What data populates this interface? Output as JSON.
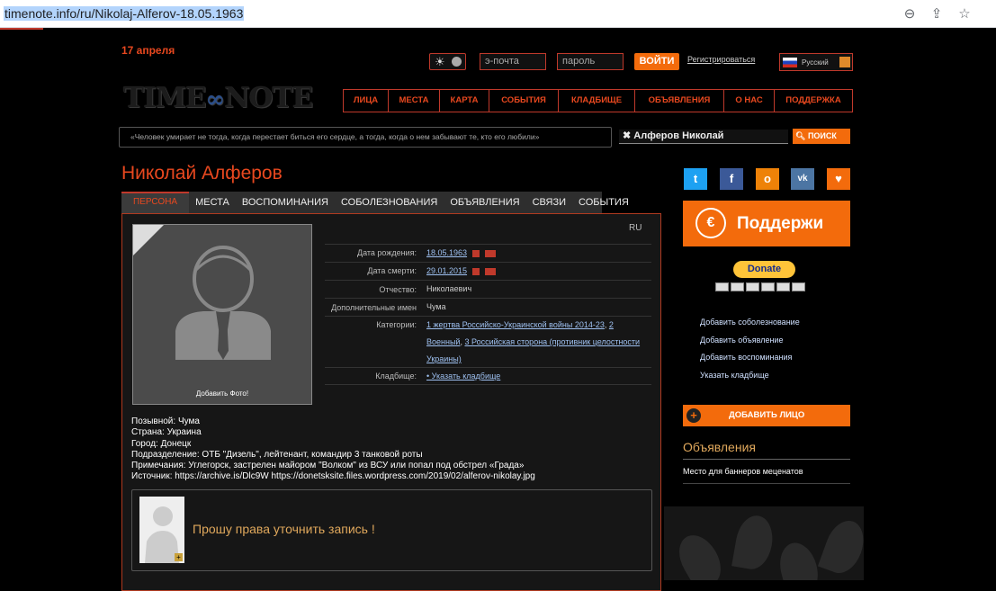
{
  "browser": {
    "url": "timenote.info/ru/Nikolaj-Alferov-18.05.1963"
  },
  "header": {
    "date": "17 апреля",
    "email_placeholder": "э-почта",
    "password_placeholder": "пароль",
    "login": "ВОЙТИ",
    "register": "Регистрироваться",
    "language": "Русский",
    "logo": {
      "left": "TIME",
      "right": "NOTE"
    },
    "nav": [
      "ЛИЦА",
      "МЕСТА",
      "КАРТА",
      "СОБЫТИЯ",
      "КЛАДБИЩЕ",
      "ОБЪЯВЛЕНИЯ",
      "О НАС",
      "ПОДДЕРЖКА"
    ],
    "quote": "«Человек умирает не тогда, когда перестает биться его сердце, а тогда, когда о нем забывают те, кто его любили»",
    "search_value": "Алферов Николай",
    "search_button": "ПОИСК"
  },
  "person": {
    "name": "Николай Алферов",
    "tabs": [
      "ПЕРСОНА",
      "МЕСТА",
      "ВОСПОМИНАНИЯ",
      "СОБОЛЕЗНОВАНИЯ",
      "ОБЪЯВЛЕНИЯ",
      "СВЯЗИ",
      "СОБЫТИЯ"
    ],
    "lang": "RU",
    "add_photo": "Добавить Фото!",
    "fields": {
      "birth_label": "Дата рождения:",
      "birth": "18.05.1963",
      "death_label": "Дата смерти:",
      "death": "29.01.2015",
      "patronymic_label": "Отчество:",
      "patronymic": "Николаевич",
      "extra_name_label": "Дополнительные имен",
      "extra_name": "Чума",
      "categories_label": "Категории:",
      "cat1": "1 жертва Российско-Украинской войны 2014-23",
      "cat1_sep": ", ",
      "cat2": "2 Военный",
      "cat2_sep": ", ",
      "cat3": "3 Российская сторона (противник целостности Украины)",
      "cemetery_label": "Кладбище:",
      "cemetery": "• Указать кладбище"
    },
    "notes": [
      "Позывной: Чума",
      "Страна: Украина",
      "Город: Донецк",
      "Подразделение: ОТБ \"Дизель\", лейтенант, командир 3 танковой роты",
      "Примечания: Углегорск, застрелен майором \"Волком\" из ВСУ или попал под обстрел «Града»",
      "Источник: https://archive.is/Dlc9W https://donetsksite.files.wordpress.com/2019/02/alferov-nikolay.jpg"
    ],
    "request": "Прошу права уточнить запись !"
  },
  "sidebar": {
    "support": "Поддержи",
    "donate": "Donate",
    "links": [
      "Добавить соболезнование",
      "Добавить объявление",
      "Добавить воспоминания",
      "Указать кладбище"
    ],
    "add_person": "ДОБАВИТЬ ЛИЦО",
    "ads_title": "Объявления",
    "ads_text": "Место для баннеров меценатов"
  },
  "colors": {
    "accent": "#f36b0c",
    "title": "#e8481f",
    "border": "#c0392b"
  }
}
